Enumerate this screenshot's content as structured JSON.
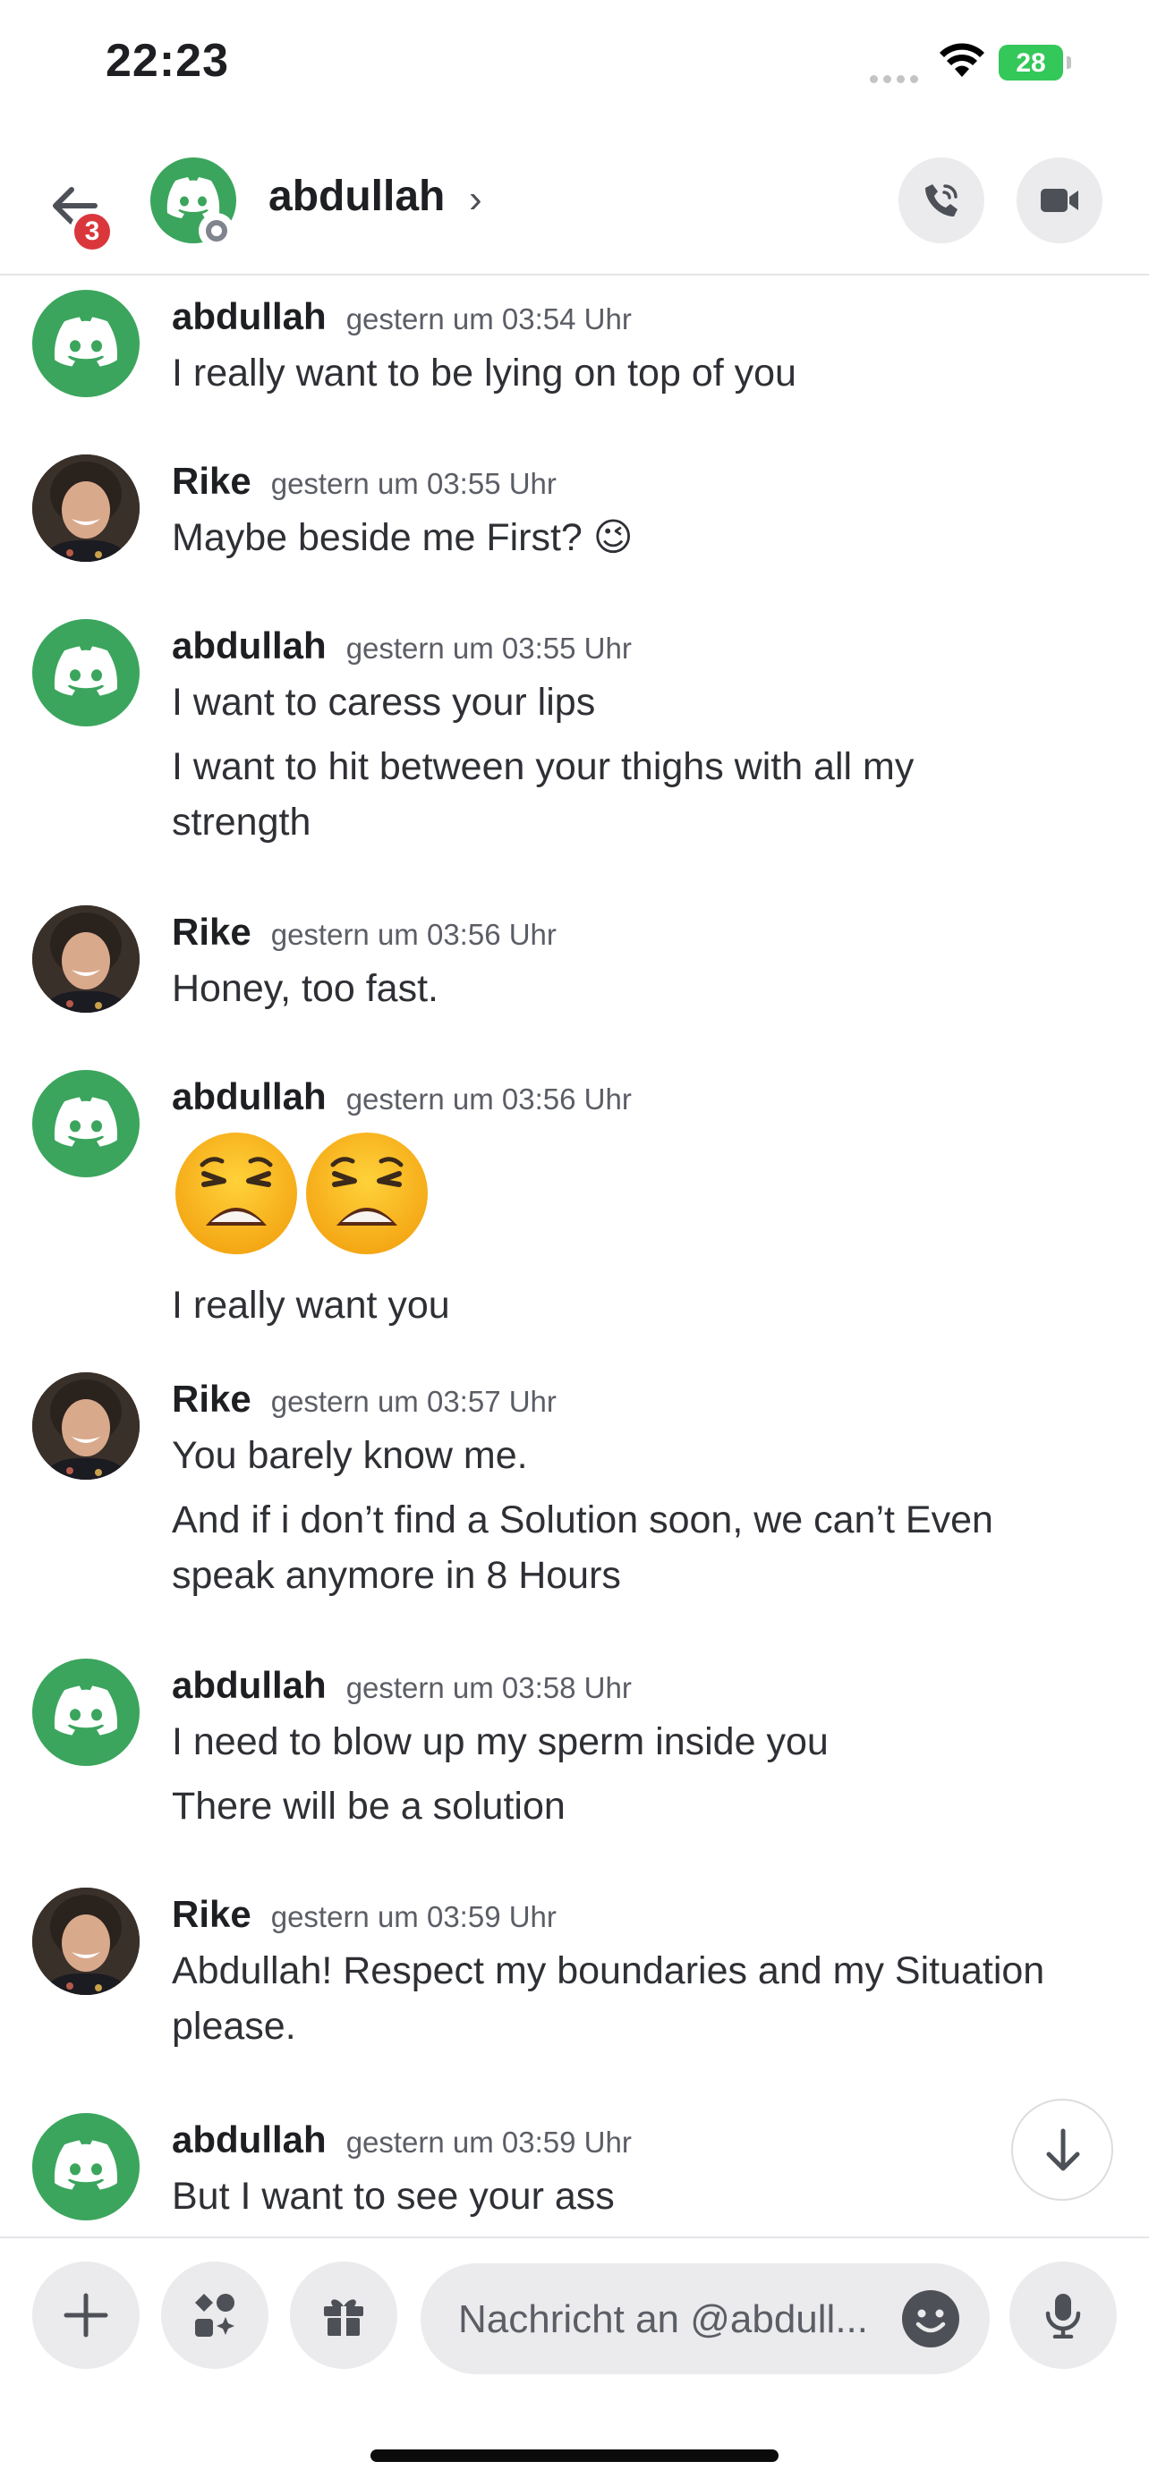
{
  "status_bar": {
    "time": "22:23",
    "battery": "28"
  },
  "header": {
    "back_badge": "3",
    "name": "abdullah",
    "chevron": "›",
    "icons": [
      "back-arrow-icon",
      "phone-call-icon",
      "video-camera-icon"
    ]
  },
  "messages": [
    {
      "author": "abdullah",
      "timestamp": "gestern um 03:54 Uhr",
      "lines": [
        "I really want to be lying on top of you"
      ]
    },
    {
      "author": "Rike",
      "timestamp": "gestern um 03:55 Uhr",
      "lines": [
        "Maybe beside me First? 😉"
      ]
    },
    {
      "author": "abdullah",
      "timestamp": "gestern um 03:55 Uhr",
      "lines": [
        "I want to caress your lips",
        "I want to hit between your thighs with all my",
        "strength"
      ]
    },
    {
      "author": "Rike",
      "timestamp": "gestern um 03:56 Uhr",
      "lines": [
        "Honey, too fast."
      ]
    },
    {
      "author": "abdullah",
      "timestamp": "gestern um 03:56 Uhr",
      "emojis": "😩😩",
      "lines": [
        "I really want you"
      ]
    },
    {
      "author": "Rike",
      "timestamp": "gestern um 03:57 Uhr",
      "lines": [
        "You barely know me.",
        "And if i don’t find a Solution soon, we can’t Even",
        "speak anymore in 8 Hours"
      ]
    },
    {
      "author": "abdullah",
      "timestamp": "gestern um 03:58 Uhr",
      "lines": [
        "I need to blow up my sperm inside you",
        "There will be a solution"
      ]
    },
    {
      "author": "Rike",
      "timestamp": "gestern um 03:59 Uhr",
      "lines": [
        "Abdullah! Respect my boundaries and my Situation",
        "please."
      ]
    },
    {
      "author": "abdullah",
      "timestamp": "gestern um 03:59 Uhr",
      "lines": [
        "But I want to see your ass"
      ]
    }
  ],
  "composer": {
    "placeholder": "Nachricht an @abdull...",
    "icons": [
      "plus-icon",
      "apps-icon",
      "gift-icon",
      "emoji-icon",
      "microphone-icon"
    ]
  },
  "colors": {
    "discord_green": "#3ba55d",
    "badge_red": "#da373c",
    "battery_green": "#34c759"
  }
}
